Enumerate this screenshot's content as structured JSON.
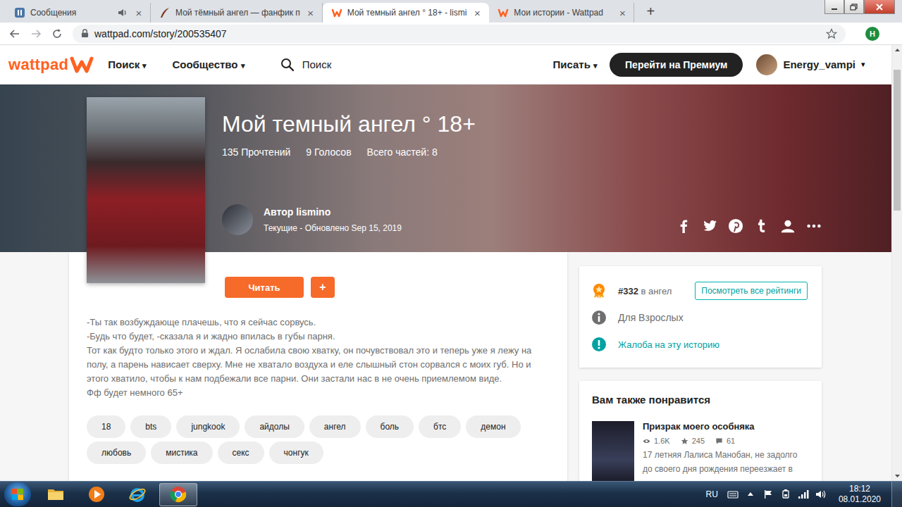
{
  "browser": {
    "tabs": [
      {
        "title": "Сообщения",
        "selected": false,
        "kind": "vk",
        "muted": true,
        "close": "×"
      },
      {
        "title": "Мой тёмный ангел — фанфик п",
        "selected": false,
        "kind": "ficbook",
        "muted": false,
        "close": "×"
      },
      {
        "title": "Мой темный ангел ° 18+ - lismi",
        "selected": true,
        "kind": "wattpad",
        "muted": false,
        "close": "×"
      },
      {
        "title": "Мои истории - Wattpad",
        "selected": false,
        "kind": "wattpad",
        "muted": false,
        "close": "×"
      }
    ],
    "new_tab": "+",
    "address": "wattpad.com/story/200535407",
    "profile": "H"
  },
  "nav": {
    "logo": "wattpad",
    "menus": [
      "Поиск",
      "Сообщество"
    ],
    "caret": "▾",
    "search": "Поиск",
    "write": "Писать",
    "premium": "Перейти на Премиум",
    "user": "Energy_vampi"
  },
  "story": {
    "title": "Мой темный ангел ° 18+",
    "stats": [
      "135 Прочтений",
      "9 Голосов",
      "Всего частей: 8"
    ],
    "author_label": "Автор",
    "author": "lismino",
    "status": "Текущие - Обновлено Sep 15, 2019",
    "read_button": "Читать",
    "add_button": "+",
    "description": [
      "-Ты так возбуждающе плачешь, что я сейчас сорвусь.",
      "-Будь что будет, -сказала я и жадно впилась в губы парня.",
      "Тот как будто только этого и ждал. Я ослабила свою хватку, он почувствовал это и теперь уже я лежу на полу, а парень нависает сверху. Мне не хватало воздуха и еле слышный стон сорвался с моих губ. Но и этого хватило, чтобы к нам подбежали все парни. Они застали нас в не очень приемлемом виде.",
      "Фф будет немного 65+"
    ],
    "tags": [
      "18",
      "bts",
      "jungkook",
      "айдолы",
      "ангел",
      "боль",
      "бтс",
      "демон",
      "любовь",
      "мистика",
      "секс",
      "чонгук"
    ]
  },
  "ranking": {
    "rank": "#332",
    "category": "в ангел",
    "button": "Посмотреть все рейтинги"
  },
  "mature": "Для Взрослых",
  "report": "Жалоба на эту историю",
  "recommend": {
    "title": "Вам также понравится",
    "items": [
      {
        "title": "Призрак моего особняка",
        "reads": "1.6K",
        "votes": "245",
        "comments": "61",
        "description": "17 летняя Лалиса Манобан, не задолго до своего дня рождения переезжает в"
      }
    ]
  },
  "taskbar": {
    "apps": [
      {
        "kind": "explorer",
        "selected": false
      },
      {
        "kind": "media",
        "selected": false
      },
      {
        "kind": "ie",
        "selected": false
      },
      {
        "kind": "chrome",
        "selected": true
      }
    ],
    "language": "RU",
    "time": "18:12",
    "date": "08.01.2020"
  }
}
